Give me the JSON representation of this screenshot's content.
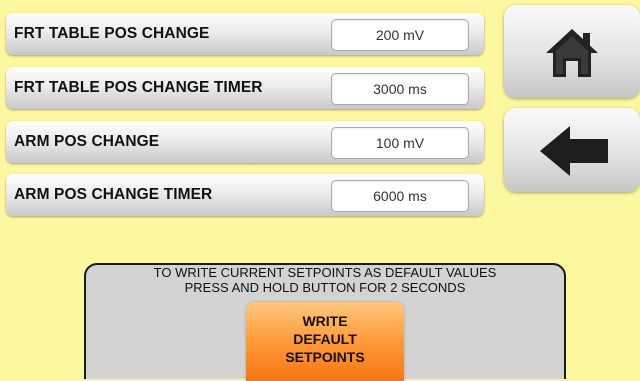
{
  "settings": [
    {
      "label": "FRT TABLE POS CHANGE",
      "value": "200 mV"
    },
    {
      "label": "FRT TABLE POS CHANGE TIMER",
      "value": "3000 ms"
    },
    {
      "label": "ARM POS CHANGE",
      "value": "100 mV"
    },
    {
      "label": "ARM POS CHANGE TIMER",
      "value": "6000 ms"
    }
  ],
  "nav": {
    "home_icon": "home-icon",
    "back_icon": "back-arrow-icon"
  },
  "default_panel": {
    "instruction_line1": "TO WRITE CURRENT SETPOINTS AS DEFAULT VALUES",
    "instruction_line2": "PRESS AND HOLD BUTTON FOR 2 SECONDS",
    "button_line1": "WRITE",
    "button_line2": "DEFAULT",
    "button_line3": "SETPOINTS"
  },
  "colors": {
    "background": "#fdf7a0",
    "write_button": "#ff9a3a",
    "panel": "#d3d3d3"
  }
}
